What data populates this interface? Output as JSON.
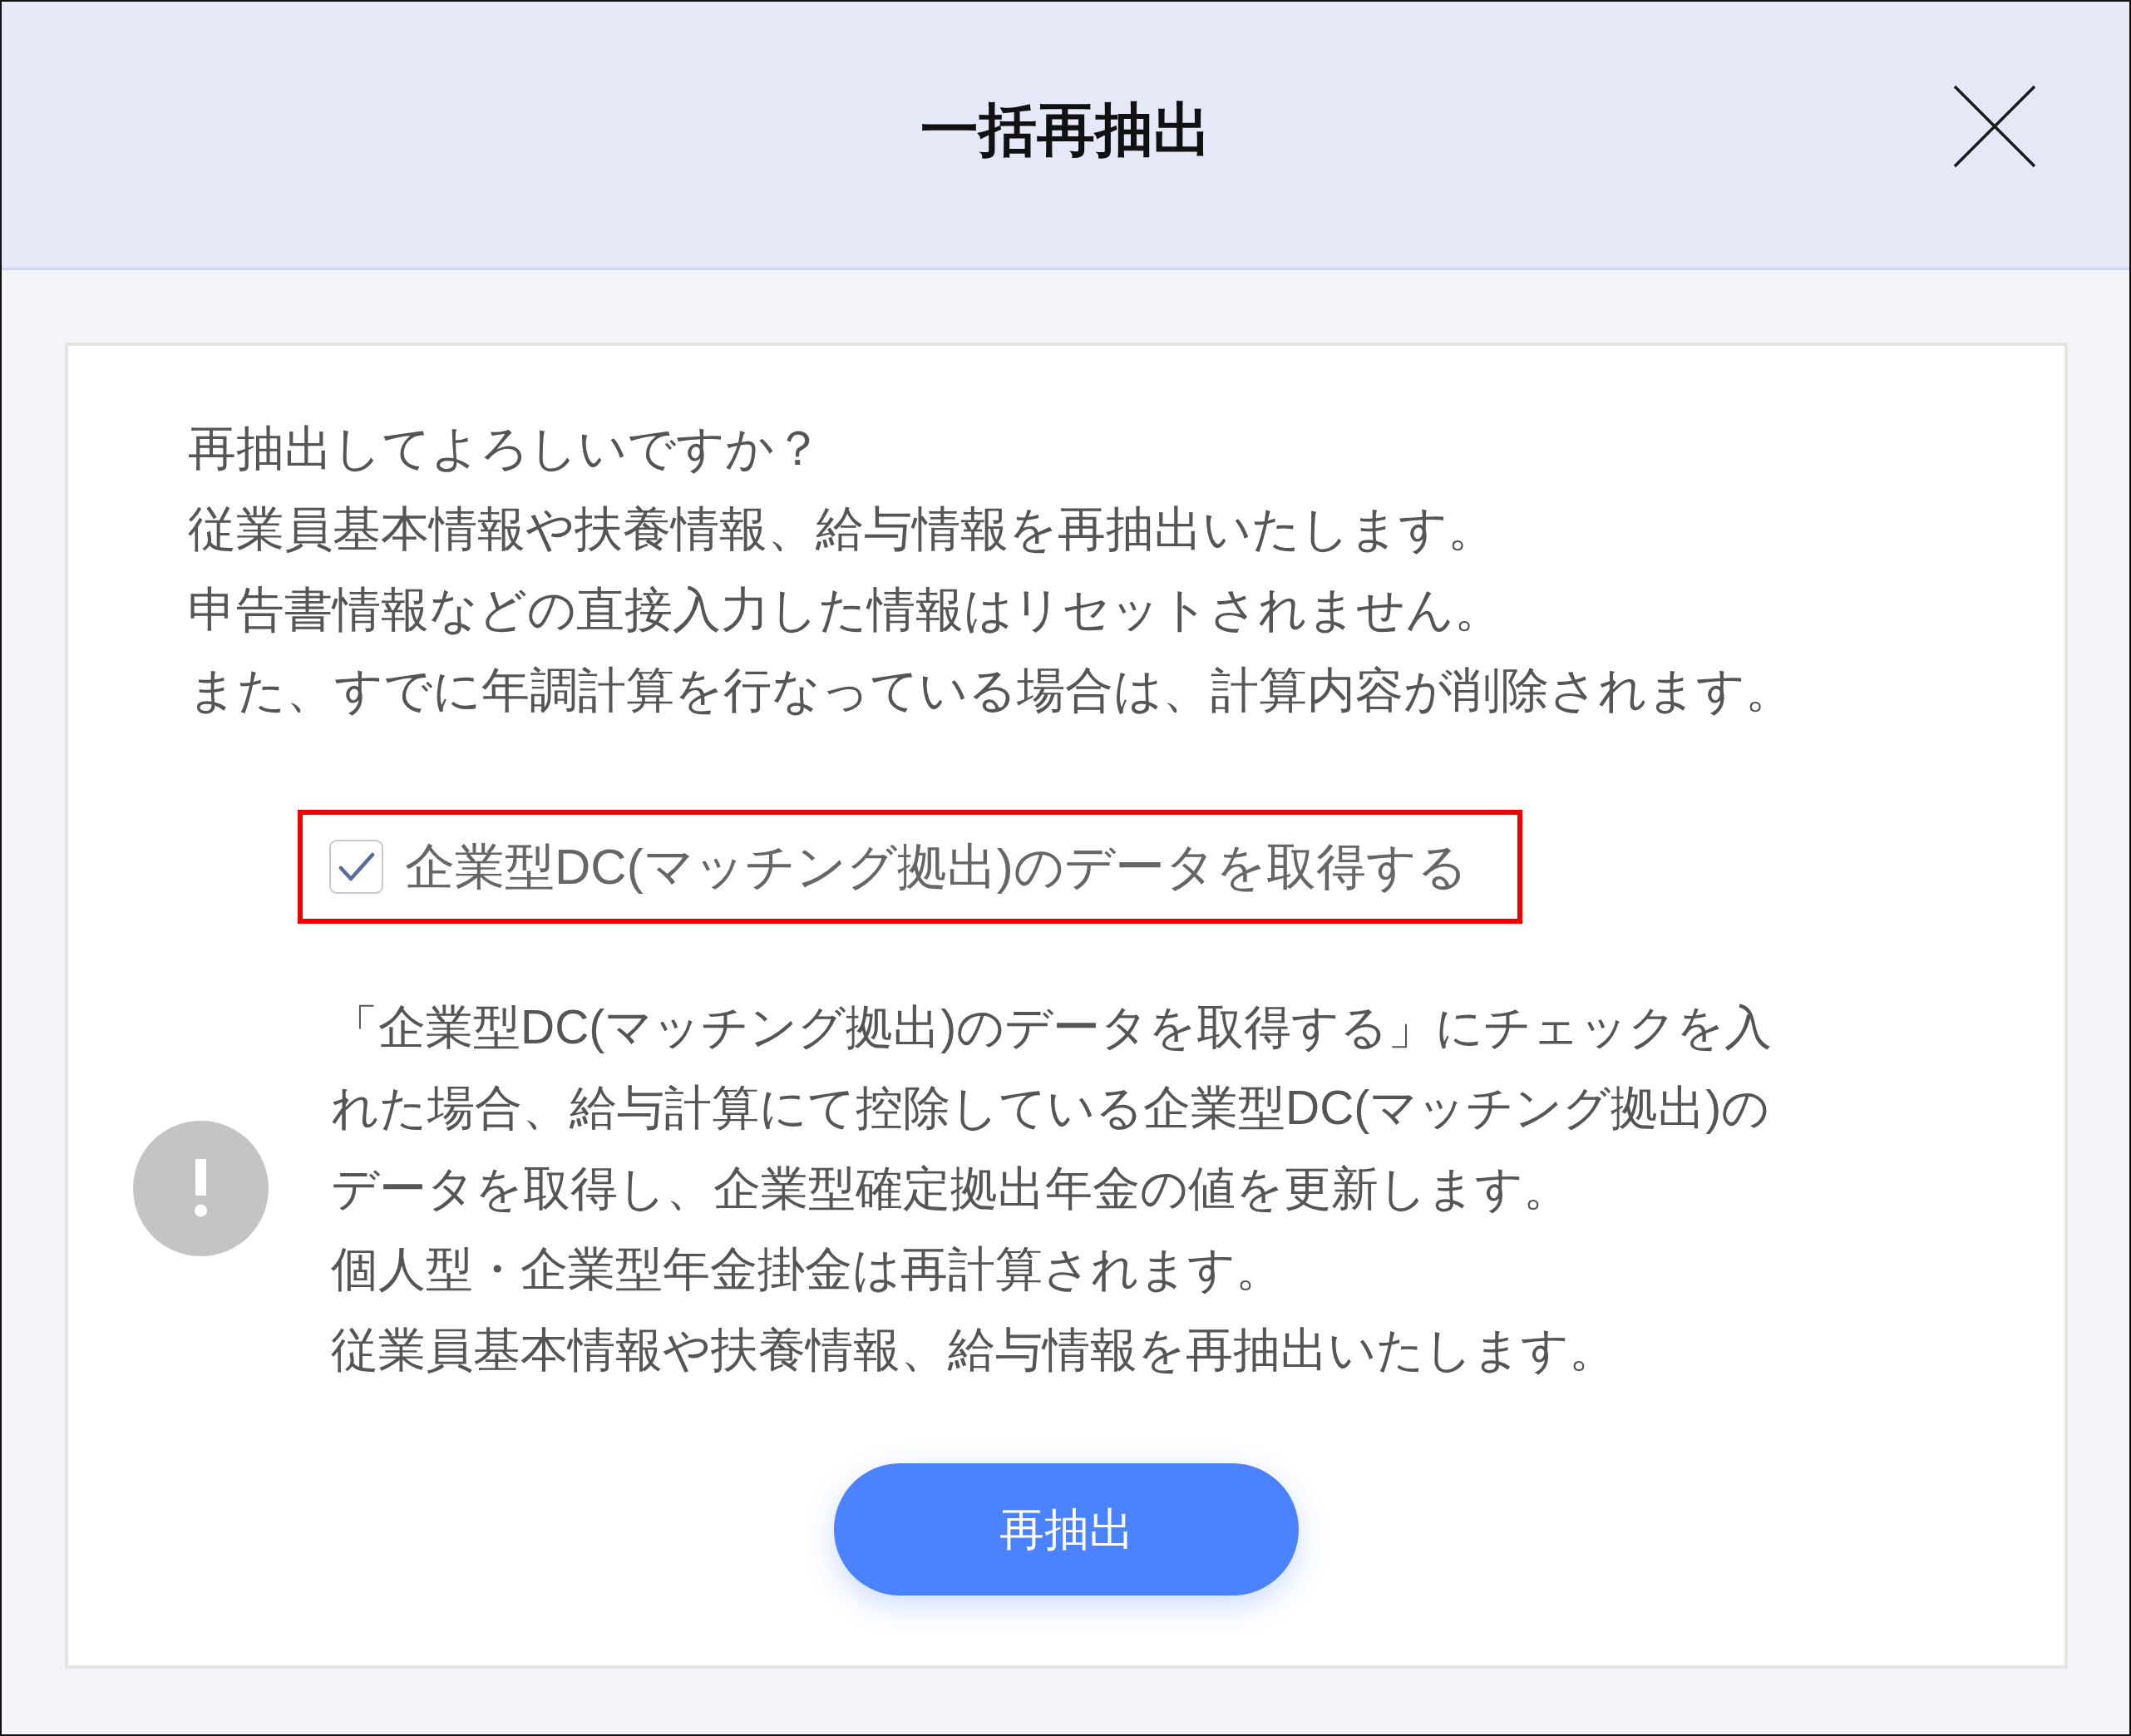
{
  "dialog": {
    "title": "一括再抽出"
  },
  "intro_lines": [
    "再抽出してよろしいですか？",
    "従業員基本情報や扶養情報、給与情報を再抽出いたします。",
    "申告書情報などの直接入力した情報はリセットされません。",
    "また、すでに年調計算を行なっている場合は、計算内容が削除されます。"
  ],
  "option": {
    "label": "企業型DC(マッチング拠出)のデータを取得する",
    "checked": true,
    "highlighted": true
  },
  "notice": {
    "paragraphs": [
      "「企業型DC(マッチング拠出)のデータを取得する」にチェックを入れた場合、給与計算にて控除している企業型DC(マッチング拠出)のデータを取得し、企業型確定拠出年金の値を更新します。",
      "個人型・企業型年金掛金は再計算されます。",
      "従業員基本情報や扶養情報、給与情報を再抽出いたします。"
    ]
  },
  "primary_button": {
    "label": "再抽出"
  }
}
